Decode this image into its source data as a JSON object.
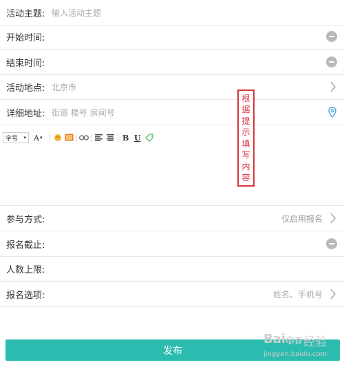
{
  "form": {
    "topic": {
      "label": "活动主题:",
      "placeholder": "输入活动主题"
    },
    "start_time": {
      "label": "开始时间:"
    },
    "end_time": {
      "label": "结束时间:"
    },
    "location": {
      "label": "活动地点:",
      "value": "北京市"
    },
    "address": {
      "label": "详细地址:",
      "placeholder": "街道 楼号 房间号"
    },
    "participation": {
      "label": "参与方式:",
      "value": "仅启用报名"
    },
    "deadline": {
      "label": "报名截止:"
    },
    "max_people": {
      "label": "人数上限:"
    },
    "signup_options": {
      "label": "报名选项:",
      "value": "姓名、手机号"
    }
  },
  "toolbar": {
    "font_size": "字号",
    "font_color": "A",
    "bold": "B",
    "underline": "U"
  },
  "annotation": {
    "chars": [
      "根",
      "据",
      "提",
      "示",
      "填",
      "写",
      "内",
      "容"
    ]
  },
  "publish_label": "发布",
  "watermark": {
    "logo": "Bai",
    "logo_suffix": "百",
    "experience": "经验",
    "url": "jingyan.baidu.com"
  },
  "colors": {
    "accent": "#2cbcaf",
    "callout": "#d9323b",
    "pin": "#3a9ad9"
  }
}
